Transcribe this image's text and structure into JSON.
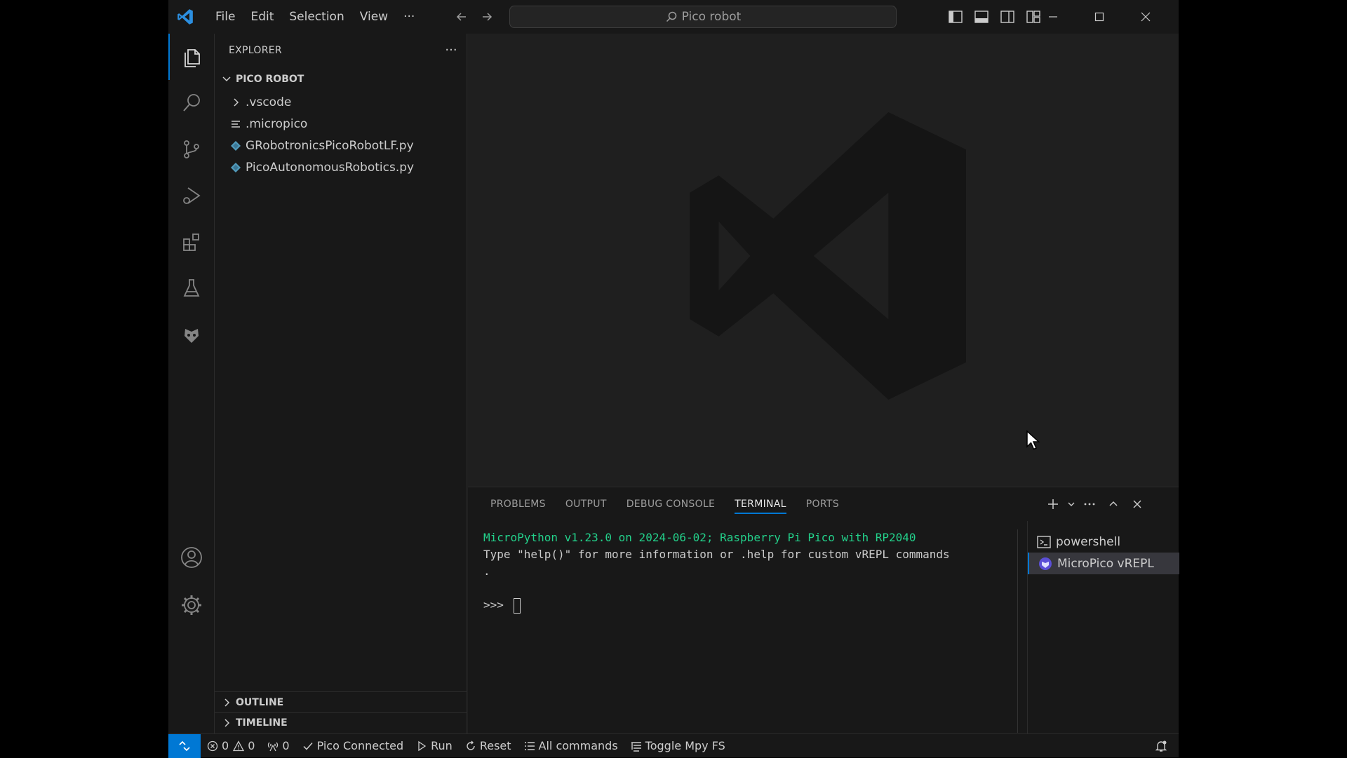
{
  "titlebar": {
    "menu": [
      "File",
      "Edit",
      "Selection",
      "View",
      "···"
    ],
    "search_text": "Pico robot"
  },
  "sidebar": {
    "title": "EXPLORER",
    "more_label": "···",
    "folder_name": "PICO ROBOT",
    "items": [
      {
        "label": ".vscode",
        "icon": "chevron-right-icon"
      },
      {
        "label": ".micropico",
        "icon": "lines-file-icon"
      },
      {
        "label": "GRobotronicsPicoRobotLF.py",
        "icon": "python-file-icon"
      },
      {
        "label": "PicoAutonomousRobotics.py",
        "icon": "python-file-icon"
      }
    ],
    "outline_label": "OUTLINE",
    "timeline_label": "TIMELINE"
  },
  "panel": {
    "tabs": [
      "PROBLEMS",
      "OUTPUT",
      "DEBUG CONSOLE",
      "TERMINAL",
      "PORTS"
    ],
    "active_tab": "TERMINAL",
    "terminal_lines": [
      "MicroPython v1.23.0 on 2024-06-02; Raspberry Pi Pico with RP2040",
      "Type \"help()\" for more information or .help for custom vREPL commands",
      "."
    ],
    "prompt": ">>> ",
    "terminals": [
      {
        "label": "powershell",
        "icon": "terminal-icon"
      },
      {
        "label": "MicroPico vREPL",
        "icon": "micropico-icon"
      }
    ]
  },
  "statusbar": {
    "errors": "0",
    "warnings": "0",
    "ports": "0",
    "pico_status": "Pico Connected",
    "run_label": "Run",
    "reset_label": "Reset",
    "all_commands_label": "All commands",
    "toggle_fs_label": "Toggle Mpy FS"
  },
  "colors": {
    "accent": "#0078d4",
    "terminal_green": "#23d18b",
    "background": "#1f1f1f",
    "chrome": "#181818"
  }
}
